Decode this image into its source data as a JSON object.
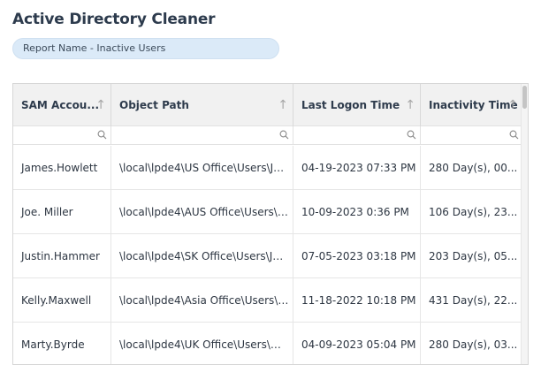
{
  "app": {
    "title": "Active Directory Cleaner"
  },
  "report": {
    "label": "Report Name - Inactive Users"
  },
  "grid": {
    "columns": [
      {
        "label": "SAM Accou..."
      },
      {
        "label": "Object Path"
      },
      {
        "label": "Last Logon Time"
      },
      {
        "label": "Inactivity Time"
      }
    ],
    "rows": [
      {
        "sam": "James.Howlett",
        "path": "\\local\\lpde4\\US Office\\Users\\Ja...",
        "logon": "04-19-2023 07:33 PM",
        "inactivity": "280 Day(s), 00..."
      },
      {
        "sam": "Joe. Miller",
        "path": "\\local\\lpde4\\AUS Office\\Users\\Jo...",
        "logon": "10-09-2023 0:36 PM",
        "inactivity": "106 Day(s), 23..."
      },
      {
        "sam": "Justin.Hammer",
        "path": "\\local\\lpde4\\SK Office\\Users\\Ju...",
        "logon": "07-05-2023 03:18 PM",
        "inactivity": "203 Day(s), 05..."
      },
      {
        "sam": "Kelly.Maxwell",
        "path": "\\local\\lpde4\\Asia Office\\Users\\Ke...",
        "logon": "11-18-2022 10:18 PM",
        "inactivity": "431 Day(s), 22..."
      },
      {
        "sam": "Marty.Byrde",
        "path": "\\local\\lpde4\\UK Office\\Users\\Ma...",
        "logon": "04-09-2023 05:04 PM",
        "inactivity": "280 Day(s), 03..."
      }
    ]
  },
  "icons": {
    "sort": "sort-up-arrow-icon",
    "filter": "magnifier-icon"
  },
  "colors": {
    "title": "#2d3b4d",
    "pill_bg": "#dbeaf8",
    "header_bg": "#f1f1f1"
  }
}
